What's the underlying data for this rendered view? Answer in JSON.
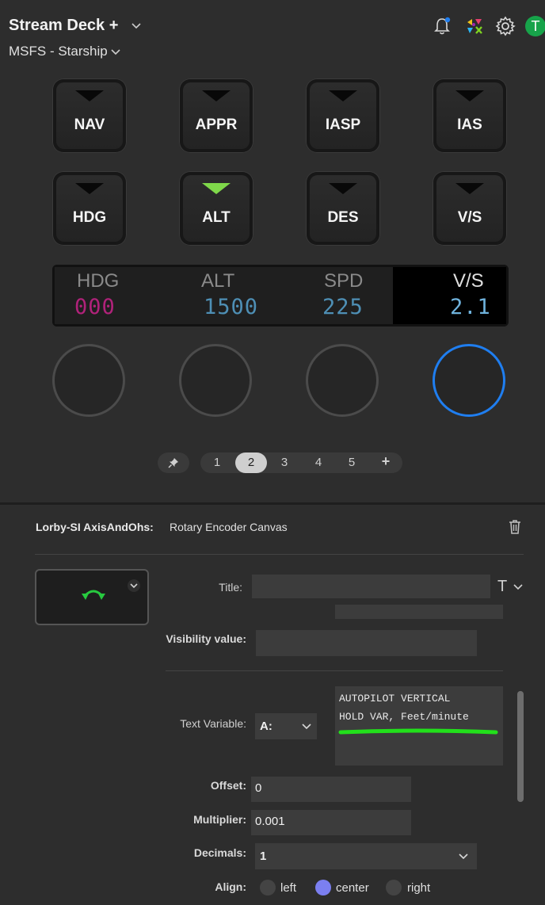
{
  "header": {
    "device_title": "Stream Deck +",
    "profile": "MSFS - Starship",
    "avatar_letter": "T"
  },
  "keys": [
    {
      "label": "NAV",
      "indicator": "off"
    },
    {
      "label": "APPR",
      "indicator": "off"
    },
    {
      "label": "IASP",
      "indicator": "off"
    },
    {
      "label": "IAS",
      "indicator": "off"
    },
    {
      "label": "HDG",
      "indicator": "off"
    },
    {
      "label": "ALT",
      "indicator": "on"
    },
    {
      "label": "DES",
      "indicator": "off"
    },
    {
      "label": "V/S",
      "indicator": "off"
    }
  ],
  "lcd": [
    {
      "heading": "HDG",
      "value": "000",
      "color": "#b0227a"
    },
    {
      "heading": "ALT",
      "value": "1500",
      "color": "#4e8fb5"
    },
    {
      "heading": "SPD",
      "value": "225",
      "color": "#4e8fb5"
    },
    {
      "heading": "V/S",
      "value": "2.1",
      "color": "#6fb2dc"
    }
  ],
  "pages": {
    "items": [
      "1",
      "2",
      "3",
      "4",
      "5"
    ],
    "selected": "2",
    "add": "+"
  },
  "properties": {
    "plugin": "Lorby-SI AxisAndOhs:",
    "action": "Rotary Encoder Canvas",
    "title_label": "Title:",
    "title_value": "",
    "title_font_glyph": "T",
    "visibility_label": "Visibility value:",
    "visibility_value": "",
    "text_variable_label": "Text Variable:",
    "variable_type": "A:",
    "variable_line1": "AUTOPILOT VERTICAL",
    "variable_line2": "HOLD VAR, Feet/minute",
    "offset_label": "Offset:",
    "offset_value": "0",
    "multiplier_label": "Multiplier:",
    "multiplier_value": "0.001",
    "decimals_label": "Decimals:",
    "decimals_value": "1",
    "align_label": "Align:",
    "align_options": [
      "left",
      "center",
      "right"
    ],
    "align_selected": "center"
  },
  "colors": {
    "accent_blue": "#1f7ef0",
    "highlight_green": "#22e01b",
    "radio_selected": "#7b7ff0"
  }
}
